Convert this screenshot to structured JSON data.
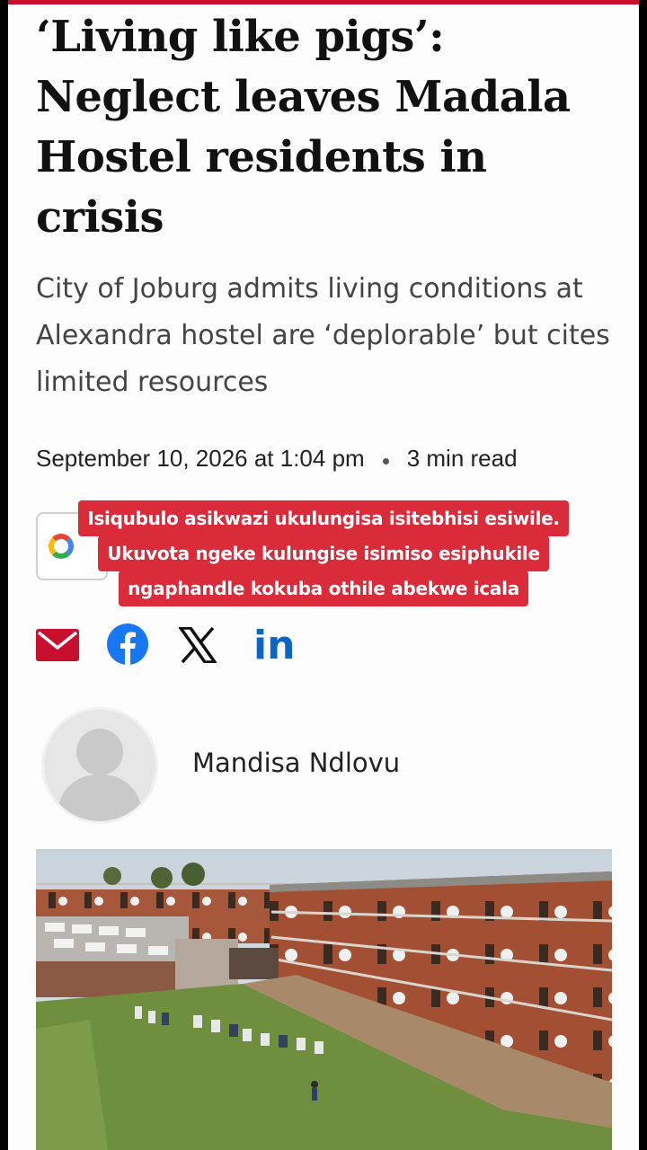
{
  "article": {
    "headline": "‘Living like pigs’: Neglect leaves Madala Hostel residents in crisis",
    "subheadline": "City of Joburg admits living conditions at Alexandra hostel are ‘deplorable’ but cites limited resources",
    "date": "September 10, 2026 at 1:04 pm",
    "read_time": "3 min read",
    "author": "Mandisa Ndlovu"
  },
  "caption": {
    "line1": "Isiqubulo asikwazi ukulungisa isitebhisi esiwile.",
    "line2": "Ukuvota ngeke kulungise isimiso esiphukile",
    "line3": "ngaphandle kokuba othile abekwe icala"
  },
  "share": {
    "icons": [
      "email-icon",
      "facebook-icon",
      "x-icon",
      "linkedin-icon"
    ],
    "linkedin_text": "in",
    "colors": {
      "email": "#c8102e",
      "facebook": "#1877f2",
      "x": "#111111",
      "linkedin": "#0a66c2"
    }
  },
  "colors": {
    "accent": "#c8102e",
    "caption_bg": "#d92b3a"
  }
}
